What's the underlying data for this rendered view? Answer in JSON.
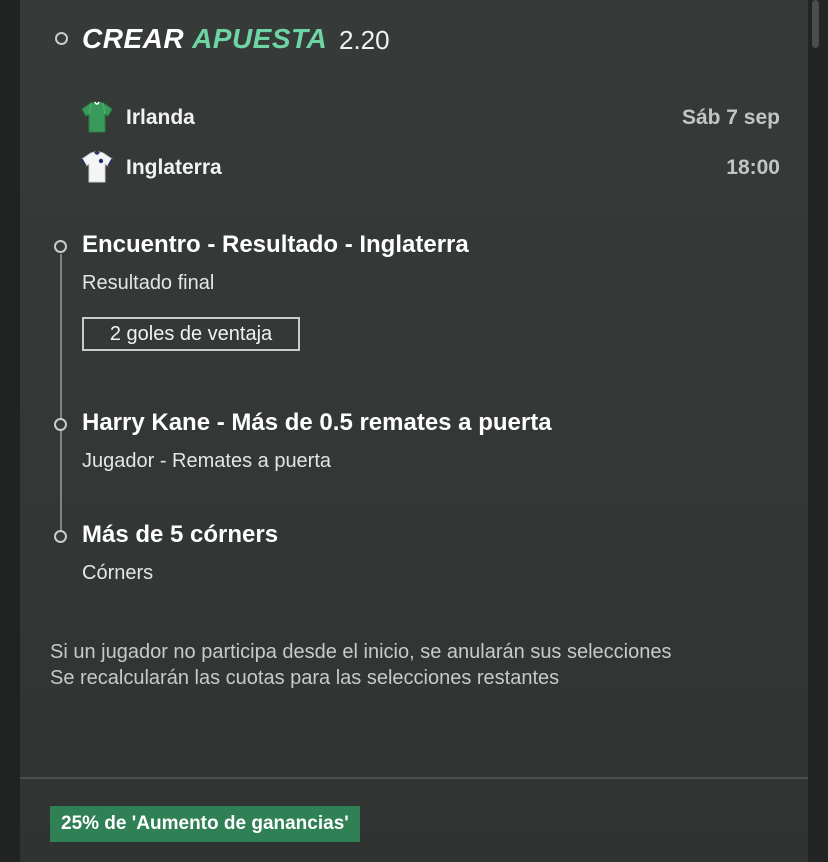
{
  "header": {
    "title_part1": "CREAR",
    "title_part2": "APUESTA",
    "odds": "2.20"
  },
  "match": {
    "home_team": "Irlanda",
    "away_team": "Inglaterra",
    "date": "Sáb 7 sep",
    "time": "18:00"
  },
  "selections": [
    {
      "title": "Encuentro - Resultado - Inglaterra",
      "subtitle": "Resultado final",
      "tag": "2 goles de ventaja"
    },
    {
      "title": "Harry Kane - Más de 0.5 remates a puerta",
      "subtitle": "Jugador - Remates a puerta"
    },
    {
      "title": "Más de 5 córners",
      "subtitle": "Córners"
    }
  ],
  "notes": {
    "line1": "Si un jugador no participa desde el inicio, se anularán sus selecciones",
    "line2": "Se recalcularán las cuotas para las selecciones restantes"
  },
  "promo": {
    "badge": "25% de 'Aumento de ganancias'"
  },
  "colors": {
    "background": "#363a38",
    "accent": "#6fd4a4",
    "promo_badge": "#2f8055",
    "home_jersey": "#3a9a5c",
    "away_jersey": "#f5f5f5"
  }
}
